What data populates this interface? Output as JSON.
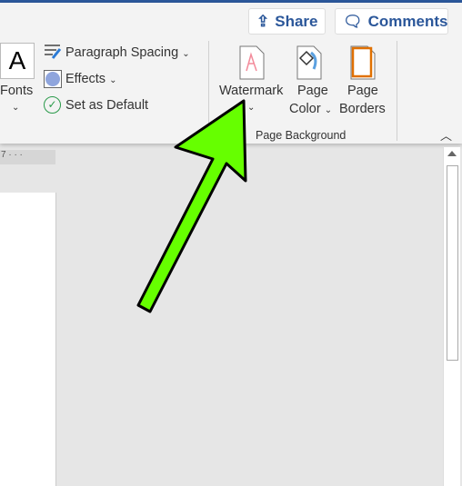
{
  "header": {
    "share_label": "Share",
    "comments_label": "Comments"
  },
  "ribbon": {
    "fonts_label": "Fonts",
    "paragraph_spacing_label": "Paragraph Spacing",
    "effects_label": "Effects",
    "set_default_label": "Set as Default",
    "watermark_label": "Watermark",
    "page_color_line1": "Page",
    "page_color_line2": "Color",
    "page_borders_line1": "Page",
    "page_borders_line2": "Borders",
    "group_label": "Page Background"
  },
  "ruler": {
    "text": "7 · · ·"
  },
  "colors": {
    "accent": "#2b579a",
    "arrow": "#66ff00"
  }
}
